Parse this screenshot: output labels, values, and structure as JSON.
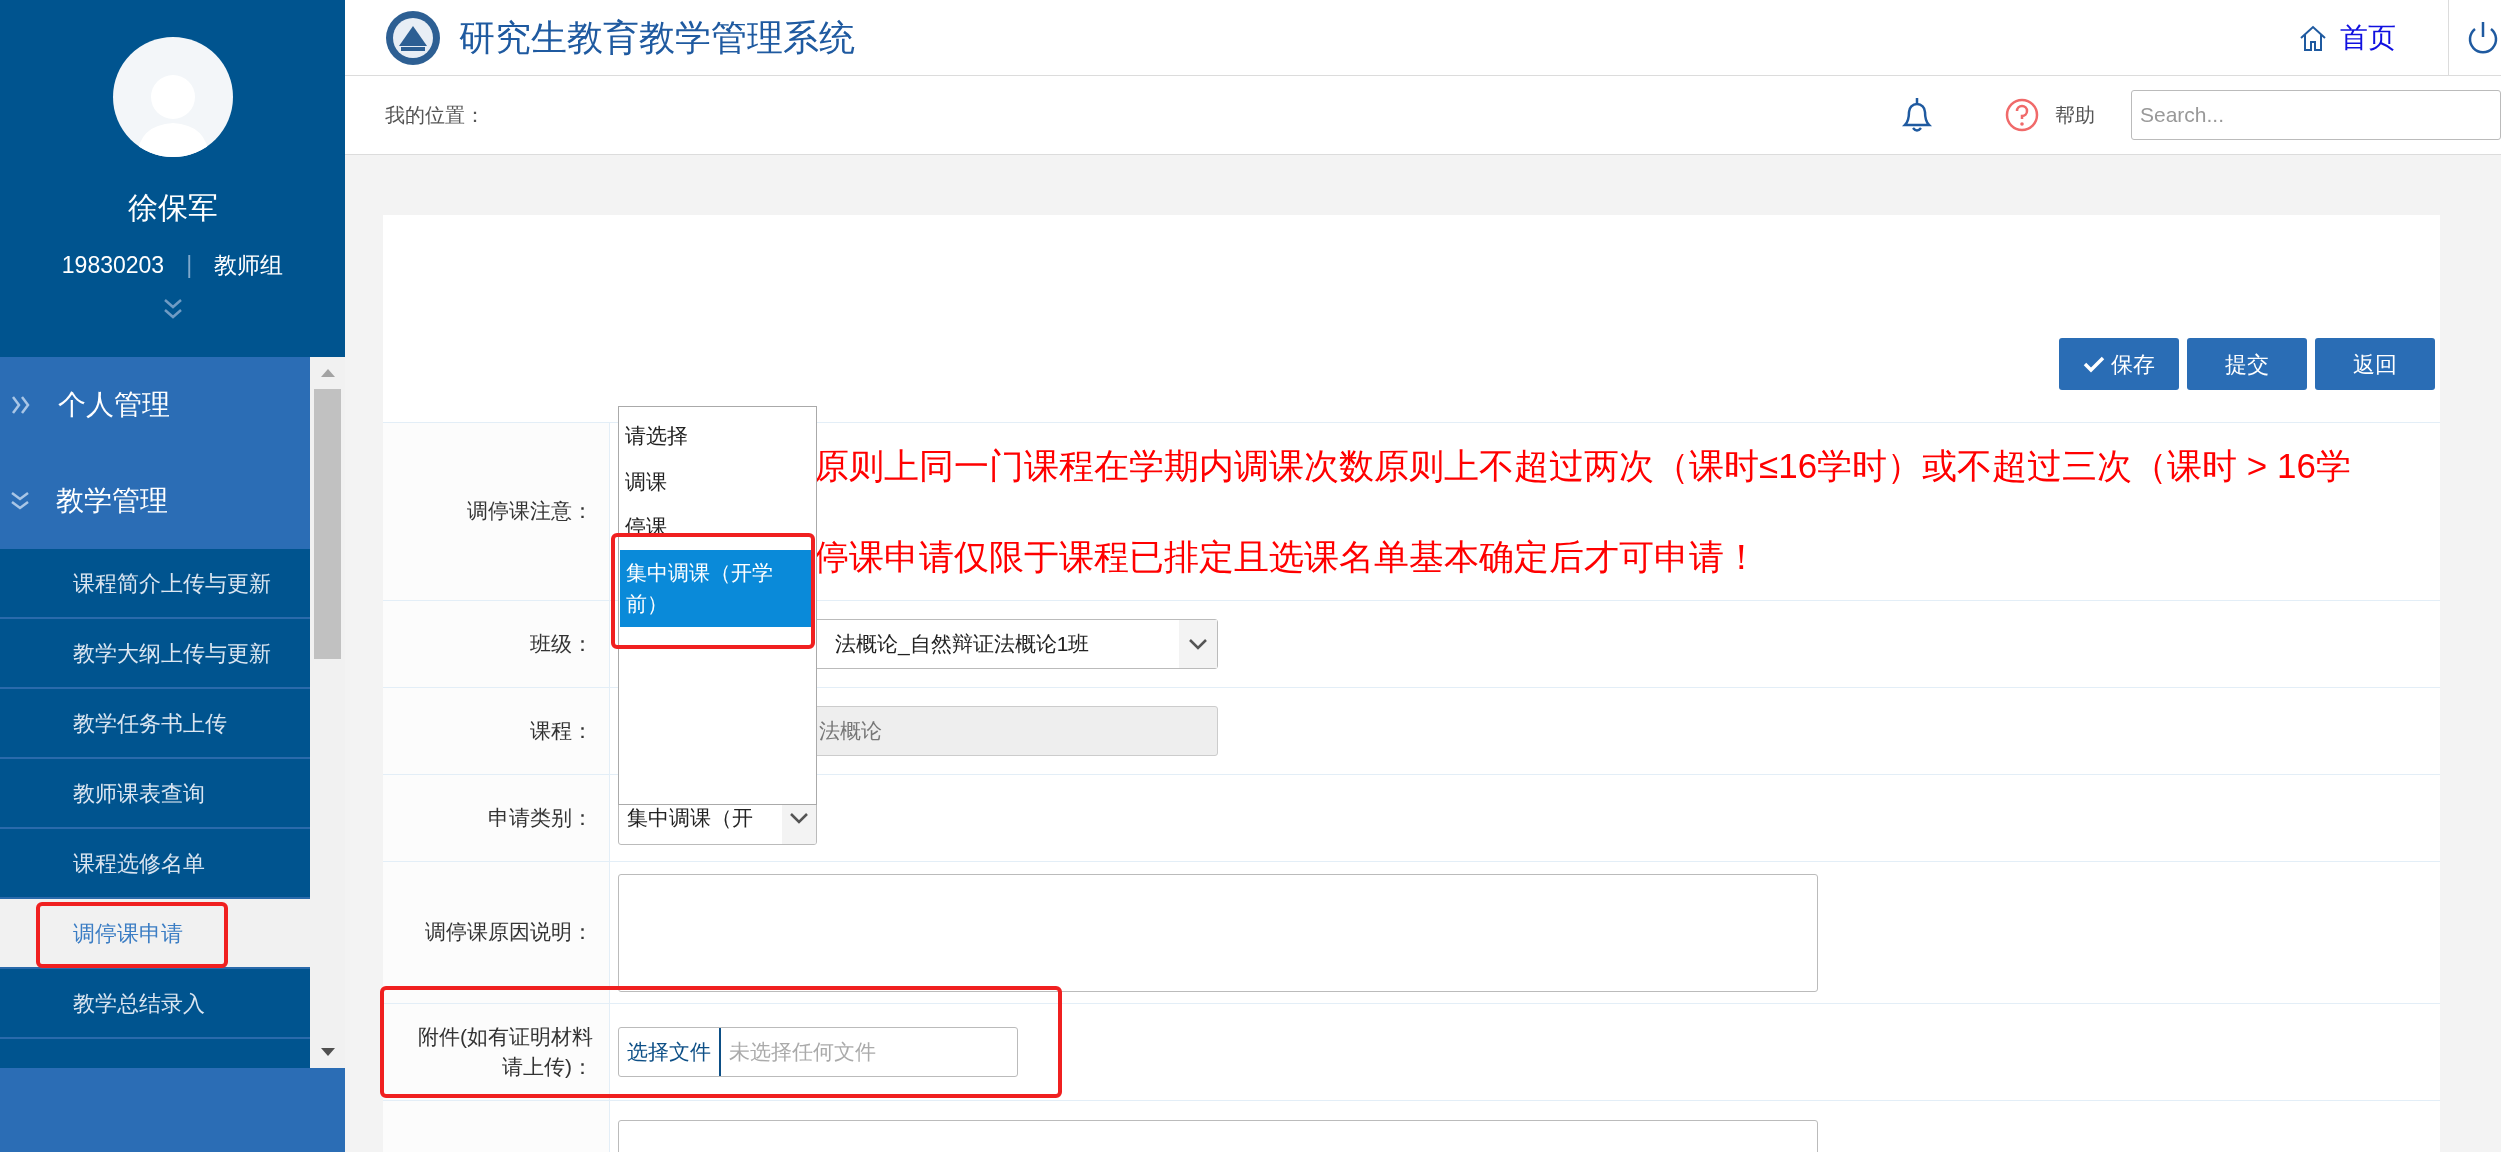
{
  "sidebar": {
    "user": {
      "name": "徐保军",
      "id": "19830203",
      "separator": "|",
      "group": "教师组"
    },
    "menu": [
      {
        "label": "个人管理",
        "expanded": false
      },
      {
        "label": "教学管理",
        "expanded": true,
        "children": [
          {
            "label": "课程简介上传与更新",
            "selected": false,
            "highlighted": false
          },
          {
            "label": "教学大纲上传与更新",
            "selected": false,
            "highlighted": false
          },
          {
            "label": "教学任务书上传",
            "selected": false,
            "highlighted": false
          },
          {
            "label": "教师课表查询",
            "selected": false,
            "highlighted": false
          },
          {
            "label": "课程选修名单",
            "selected": false,
            "highlighted": false
          },
          {
            "label": "调停课申请",
            "selected": true,
            "highlighted": true
          },
          {
            "label": "教学总结录入",
            "selected": false,
            "highlighted": false
          }
        ]
      }
    ]
  },
  "header": {
    "title": "研究生教育教学管理系统",
    "home_link": "首页"
  },
  "location_bar": {
    "label": "我的位置：",
    "help": "帮助",
    "search": {
      "placeholder": "Search..."
    }
  },
  "toolbar": [
    {
      "label": "保存",
      "kind": "check"
    },
    {
      "label": "提交",
      "kind": "plain"
    },
    {
      "label": "返回",
      "kind": "plain"
    }
  ],
  "form": [
    {
      "kind": "notice",
      "label": "调停课注意：",
      "lines": [
        "原则上同一门课程在学期内调课次数原则上不超过两次（课时≤16学时）或不超过三次（课时 > 16学",
        "停课申请仅限于课程已排定且选课名单基本确定后才可申请！"
      ]
    },
    {
      "kind": "select",
      "label": "班级：",
      "value": "法概论_自然辩证法概论1班"
    },
    {
      "kind": "readonly",
      "label": "课程：",
      "value": "法概论"
    },
    {
      "kind": "select",
      "label": "申请类别：",
      "value": "集中调课（开",
      "expanded": true,
      "options": [
        {
          "label": "请选择",
          "selected": false,
          "highlighted": false
        },
        {
          "label": "调课",
          "selected": false,
          "highlighted": false
        },
        {
          "label": "停课",
          "selected": false,
          "highlighted": false
        },
        {
          "label": "集中调课（开学前）",
          "selected": true,
          "highlighted": true
        }
      ]
    },
    {
      "kind": "textarea",
      "label": "调停课原因说明："
    },
    {
      "kind": "file",
      "label": "附件(如有证明材料请上传)：",
      "button": "选择文件",
      "placeholder": "未选择任何文件",
      "highlighted": true
    },
    {
      "kind": "textarea"
    }
  ]
}
